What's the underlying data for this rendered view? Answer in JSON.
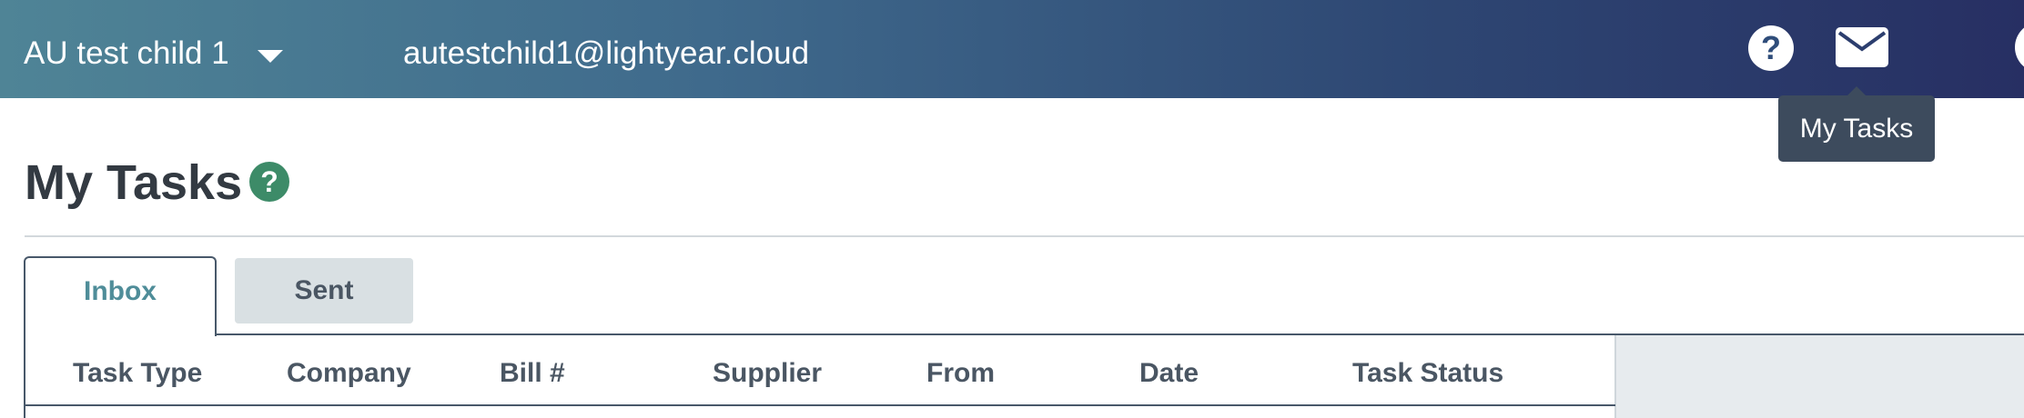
{
  "topbar": {
    "company_name": "AU test child 1",
    "user_email": "autestchild1@lightyear.cloud",
    "help_icon_glyph": "?",
    "mail_icon": "envelope-icon"
  },
  "tooltip": {
    "label": "My Tasks"
  },
  "page": {
    "title": "My Tasks",
    "help_icon_glyph": "?"
  },
  "tabs": [
    {
      "label": "Inbox",
      "active": true
    },
    {
      "label": "Sent",
      "active": false
    }
  ],
  "table": {
    "columns": [
      "Task Type",
      "Company",
      "Bill #",
      "Supplier",
      "From",
      "Date",
      "Task Status"
    ]
  },
  "colors": {
    "accent_teal": "#4f8d99",
    "help_green": "#3d8b68",
    "topbar_start": "#4f8496",
    "topbar_end": "#272f63"
  }
}
